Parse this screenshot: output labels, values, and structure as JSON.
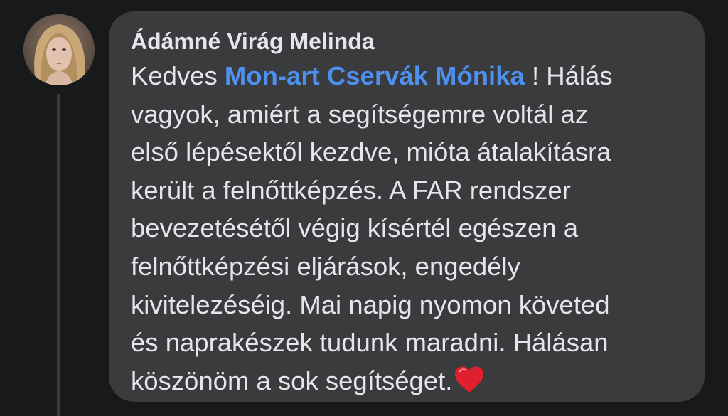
{
  "comment": {
    "author": "Ádámné Virág Melinda",
    "mention": "Mon-art Cservák Mónika",
    "text_before_mention": "Kedves",
    "lines": [
      " ! Hálás",
      "vagyok, amiért a segítségemre voltál az",
      "első lépésektől kezdve, mióta átalakításra",
      "került a felnőttképzés. A FAR rendszer",
      "bevezetésétől végig kísértél egészen a",
      "felnőttképzési eljárások, engedély",
      "kivitelezéséig. Mai napig nyomon követed",
      "és naprakészek tudunk maradni. Hálásan",
      "köszönöm a sok segítséget."
    ],
    "emoji": "heart-icon"
  },
  "colors": {
    "background": "#18191a",
    "bubble": "#3a3b3c",
    "text": "#e4e6eb",
    "mention": "#4e90f0",
    "heart": "#e0202e"
  }
}
